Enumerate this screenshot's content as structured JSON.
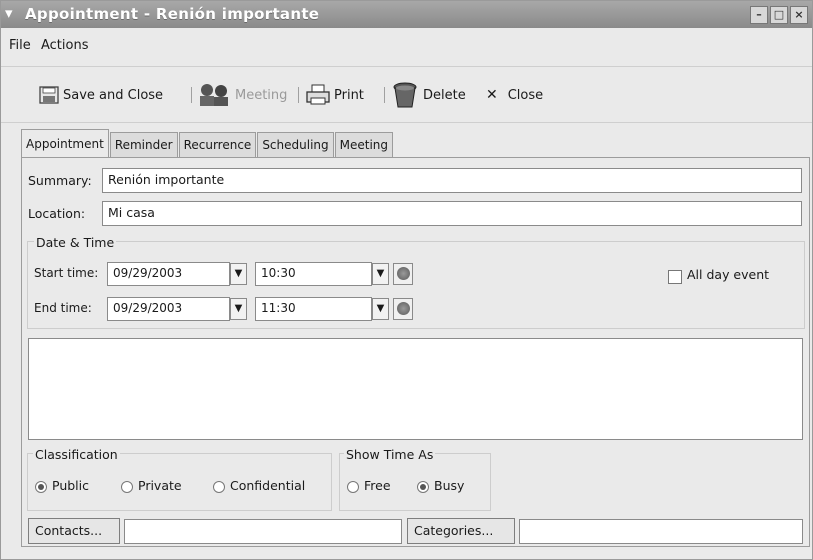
{
  "window": {
    "title": "Appointment - Renión importante",
    "controls": [
      "minimize-icon",
      "maximize-icon",
      "close-icon"
    ]
  },
  "menu": {
    "file": "File",
    "actions": "Actions"
  },
  "toolbar": {
    "save_close": "Save and Close",
    "meeting": "Meeting",
    "print": "Print",
    "delete": "Delete",
    "close": "Close"
  },
  "tabs": [
    "Appointment",
    "Reminder",
    "Recurrence",
    "Scheduling",
    "Meeting"
  ],
  "form": {
    "summary_label": "Summary:",
    "summary_value": "Renión importante",
    "location_label": "Location:",
    "location_value": "Mi casa",
    "datetime_group": "Date & Time",
    "start_label": "Start time:",
    "start_date": "09/29/2003",
    "start_time": "10:30",
    "end_label": "End time:",
    "end_date": "09/29/2003",
    "end_time": "11:30",
    "all_day_label": "All day event",
    "all_day_checked": false,
    "description": "",
    "classification_group": "Classification",
    "classification_options": [
      "Public",
      "Private",
      "Confidential"
    ],
    "classification_selected": "Public",
    "show_time_group": "Show Time As",
    "show_time_options": [
      "Free",
      "Busy"
    ],
    "show_time_selected": "Busy",
    "contacts_button": "Contacts...",
    "contacts_value": "",
    "categories_button": "Categories...",
    "categories_value": ""
  }
}
